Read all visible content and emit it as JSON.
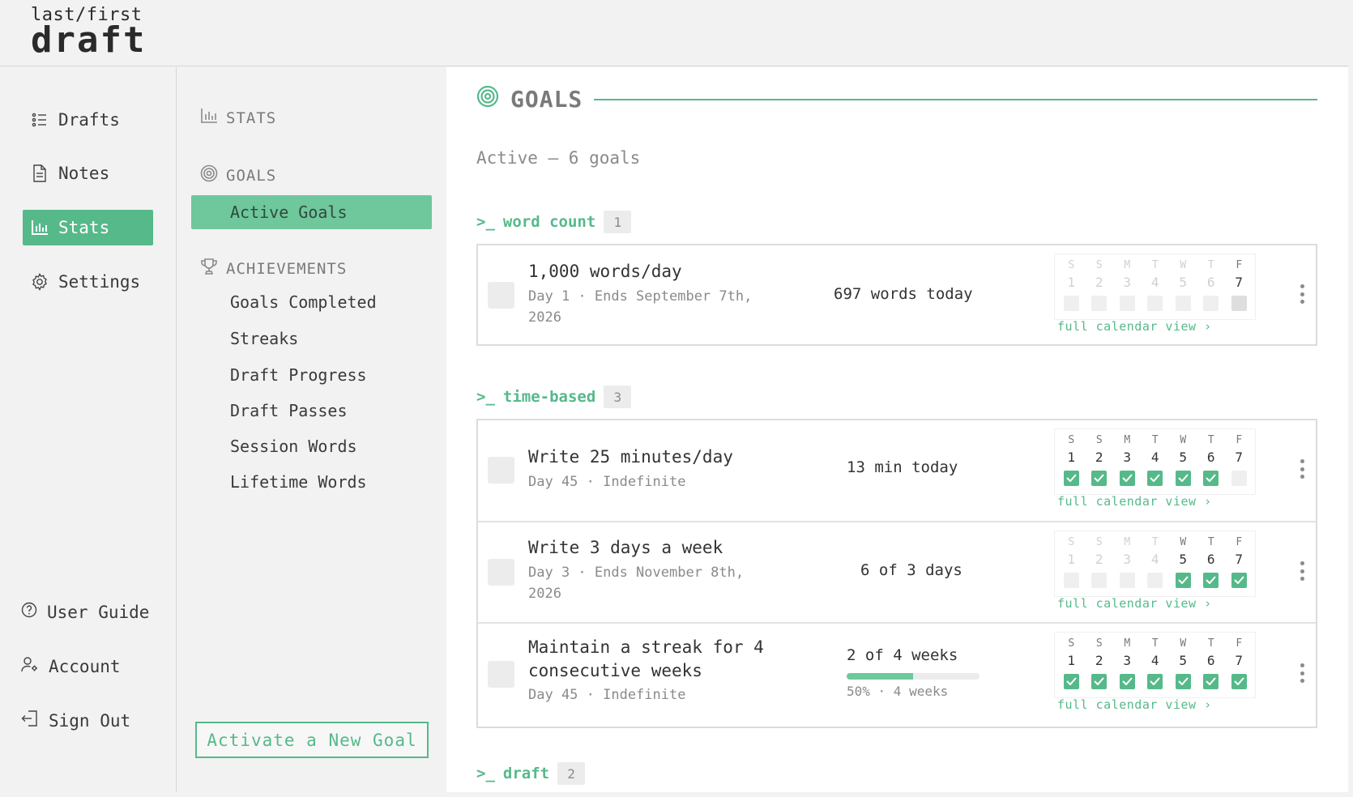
{
  "logo": {
    "line1": "last/first",
    "line2": "draft"
  },
  "nav": {
    "items": [
      {
        "label": "Drafts",
        "icon": "list-icon"
      },
      {
        "label": "Notes",
        "icon": "document-icon"
      },
      {
        "label": "Stats",
        "icon": "bar-chart-icon",
        "active": true
      },
      {
        "label": "Settings",
        "icon": "gear-icon"
      }
    ],
    "bottom": [
      {
        "label": "User Guide",
        "icon": "help-circle-icon"
      },
      {
        "label": "Account",
        "icon": "user-gear-icon"
      },
      {
        "label": "Sign Out",
        "icon": "sign-out-icon"
      }
    ]
  },
  "subnav": {
    "stats_label": "STATS",
    "goals_label": "GOALS",
    "active_goals": "Active Goals",
    "achievements_label": "ACHIEVEMENTS",
    "achievement_links": [
      "Goals Completed",
      "Streaks",
      "Draft Progress",
      "Draft Passes",
      "Session Words",
      "Lifetime Words"
    ],
    "activate_button": "Activate a New Goal"
  },
  "main": {
    "title": "GOALS",
    "active_summary": "Active — 6 goals",
    "calendar_link": "full calendar view ›",
    "day_names": [
      "S",
      "S",
      "M",
      "T",
      "W",
      "T",
      "F"
    ],
    "day_numbers": [
      "1",
      "2",
      "3",
      "4",
      "5",
      "6",
      "7"
    ],
    "categories": [
      {
        "prompt": ">_",
        "name": "word count",
        "count": "1"
      },
      {
        "prompt": ">_",
        "name": "time-based",
        "count": "3"
      },
      {
        "prompt": ">_",
        "name": "draft",
        "count": "2"
      }
    ],
    "goals": [
      {
        "name": "1,000 words/day",
        "meta": "Day 1 · Ends September 7th, 2026",
        "progress": "697 words today"
      },
      {
        "name": "Write 25 minutes/day",
        "meta": "Day 45 · Indefinite",
        "progress": "13 min today"
      },
      {
        "name": "Write 3 days a week",
        "meta": "Day 3 · Ends November 8th, 2026",
        "progress": "6 of 3 days"
      },
      {
        "name": "Maintain a streak for 4 consecutive weeks",
        "meta": "Day 45 · Indefinite",
        "progress": "2 of 4 weeks",
        "bar_label": "50% · 4 weeks",
        "bar_fraction": 0.5
      }
    ]
  },
  "colors": {
    "accent": "#56b98a",
    "accent_light": "#6fc79c"
  }
}
